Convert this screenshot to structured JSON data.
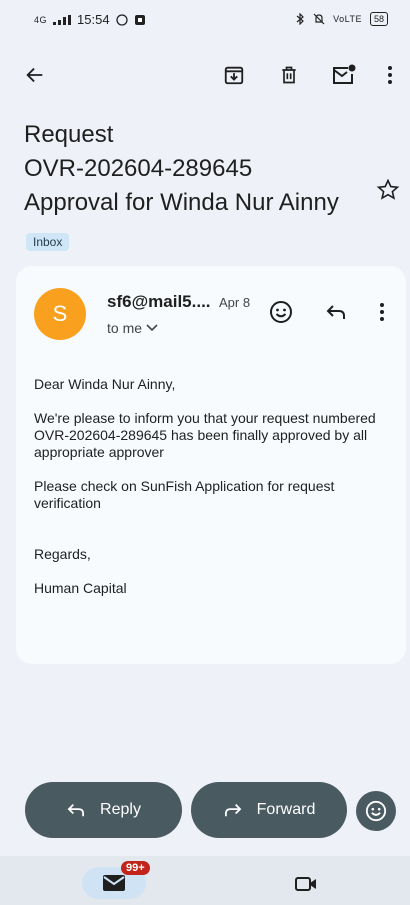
{
  "status_bar": {
    "network": "4G",
    "time": "15:54",
    "right_label": "VoLTE",
    "battery": "58"
  },
  "subject": {
    "line1": "Request",
    "line2": "OVR-202604-289645",
    "line3": "Approval for Winda Nur Ainny",
    "label_chip": "Inbox"
  },
  "message": {
    "avatar_letter": "S",
    "avatar_color": "#f9a01f",
    "sender": "sf6@mail5....",
    "date": "Apr 8",
    "recipient": "to me",
    "body": [
      "Dear Winda Nur Ainny,",
      "We're please to inform you that your request numbered OVR-202604-289645 has been finally approved by all appropriate approver",
      "Please check on SunFish Application for request verification",
      "Regards,",
      "Human Capital"
    ]
  },
  "actions": {
    "reply": "Reply",
    "forward": "Forward"
  },
  "bottom_nav": {
    "mail_badge": "99+"
  },
  "colors": {
    "background": "#eef1f7",
    "card": "#f7fbfe",
    "pill": "#4a5a61",
    "badge": "#c2241b"
  }
}
